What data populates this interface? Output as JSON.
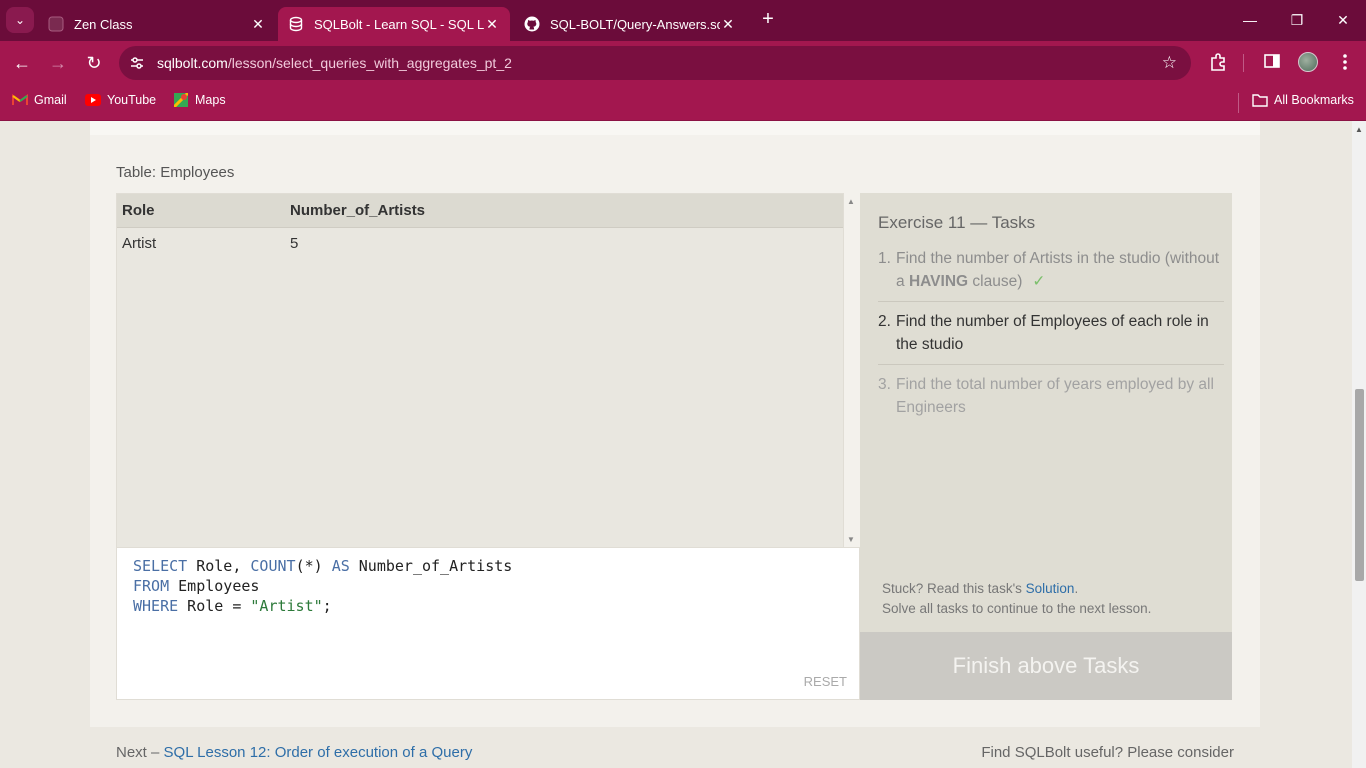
{
  "browser": {
    "tabs": [
      {
        "title": "Zen Class",
        "active": false
      },
      {
        "title": "SQLBolt - Learn SQL - SQL Less",
        "active": true
      },
      {
        "title": "SQL-BOLT/Query-Answers.sql at",
        "active": false
      }
    ],
    "url_host": "sqlbolt.com",
    "url_path": "/lesson/select_queries_with_aggregates_pt_2",
    "bookmarks": [
      {
        "label": "Gmail",
        "icon": "gmail-icon"
      },
      {
        "label": "YouTube",
        "icon": "youtube-icon"
      },
      {
        "label": "Maps",
        "icon": "maps-icon"
      }
    ],
    "all_bookmarks": "All Bookmarks",
    "colors": {
      "tabstrip": "#6b0c3a",
      "toolbar": "#a3174f"
    }
  },
  "lesson": {
    "table_label": "Table: Employees",
    "result": {
      "columns": [
        "Role",
        "Number_of_Artists"
      ],
      "rows": [
        [
          "Artist",
          "5"
        ]
      ]
    },
    "query": {
      "line1": {
        "kw1": "SELECT",
        "t1": " Role, ",
        "kw2": "COUNT",
        "t2": "(*) ",
        "kw3": "AS",
        "t3": " Number_of_Artists"
      },
      "line2": {
        "kw1": "FROM",
        "t1": " Employees"
      },
      "line3": {
        "kw1": "WHERE",
        "t1": " Role = ",
        "str": "\"Artist\"",
        "t2": ";"
      }
    },
    "reset_label": "RESET",
    "tasks_title": "Exercise 11 — Tasks",
    "tasks": [
      {
        "num": "1.",
        "text_a": "Find the number of Artists in the studio (without a ",
        "text_b": "HAVING",
        "text_c": " clause)",
        "check": "✓"
      },
      {
        "num": "2.",
        "text": "Find the number of Employees of each role in the studio"
      },
      {
        "num": "3.",
        "text": "Find the total number of years employed by all Engineers"
      }
    ],
    "stuck_prefix": "Stuck? Read this task's ",
    "solution_link": "Solution",
    "stuck_suffix": ".",
    "solve_all": "Solve all tasks to continue to the next lesson.",
    "finish_label": "Finish above Tasks",
    "next_prefix": "Next – ",
    "next_link": "SQL Lesson 12: Order of execution of a Query",
    "useful": "Find SQLBolt useful? Please consider"
  }
}
